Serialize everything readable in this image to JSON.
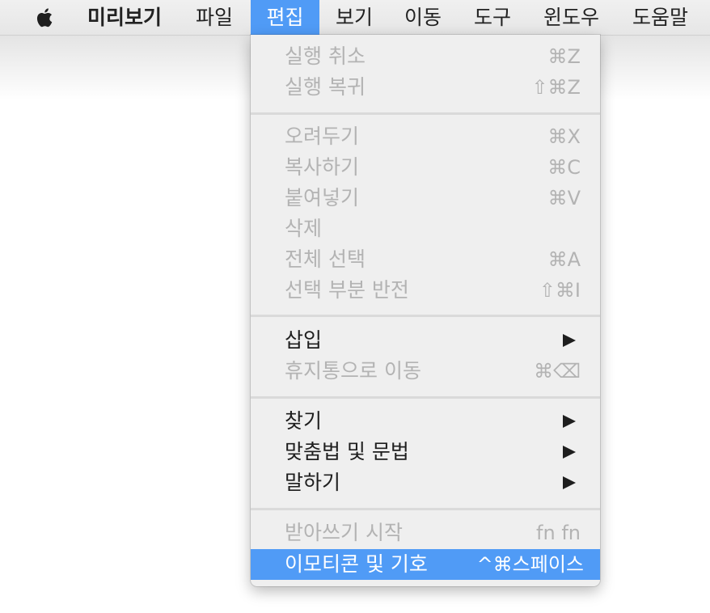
{
  "menubar": {
    "app_name": "미리보기",
    "items": [
      "파일",
      "편집",
      "보기",
      "이동",
      "도구",
      "윈도우",
      "도움말"
    ],
    "active_item": "편집",
    "highlight_color": "#509bf6"
  },
  "edit_menu": {
    "undo": {
      "label": "실행 취소",
      "shortcut": "⌘Z",
      "enabled": false
    },
    "redo": {
      "label": "실행 복귀",
      "shortcut": "⇧⌘Z",
      "enabled": false
    },
    "cut": {
      "label": "오려두기",
      "shortcut": "⌘X",
      "enabled": false
    },
    "copy": {
      "label": "복사하기",
      "shortcut": "⌘C",
      "enabled": false
    },
    "paste": {
      "label": "붙여넣기",
      "shortcut": "⌘V",
      "enabled": false
    },
    "delete": {
      "label": "삭제",
      "shortcut": "",
      "enabled": false
    },
    "select_all": {
      "label": "전체 선택",
      "shortcut": "⌘A",
      "enabled": false
    },
    "invert_selection": {
      "label": "선택 부분 반전",
      "shortcut": "⇧⌘I",
      "enabled": false
    },
    "insert": {
      "label": "삽입",
      "submenu": true,
      "enabled": true
    },
    "move_to_trash": {
      "label": "휴지통으로 이동",
      "shortcut": "⌘⌫",
      "enabled": false
    },
    "find": {
      "label": "찾기",
      "submenu": true,
      "enabled": true
    },
    "spelling_grammar": {
      "label": "맞춤법 및 문법",
      "submenu": true,
      "enabled": true
    },
    "speech": {
      "label": "말하기",
      "submenu": true,
      "enabled": true
    },
    "start_dictation": {
      "label": "받아쓰기 시작",
      "shortcut": "fn fn",
      "enabled": false
    },
    "emoji_symbols": {
      "label": "이모티콘 및 기호",
      "shortcut": "^⌘스페이스",
      "enabled": true,
      "highlighted": true
    }
  }
}
